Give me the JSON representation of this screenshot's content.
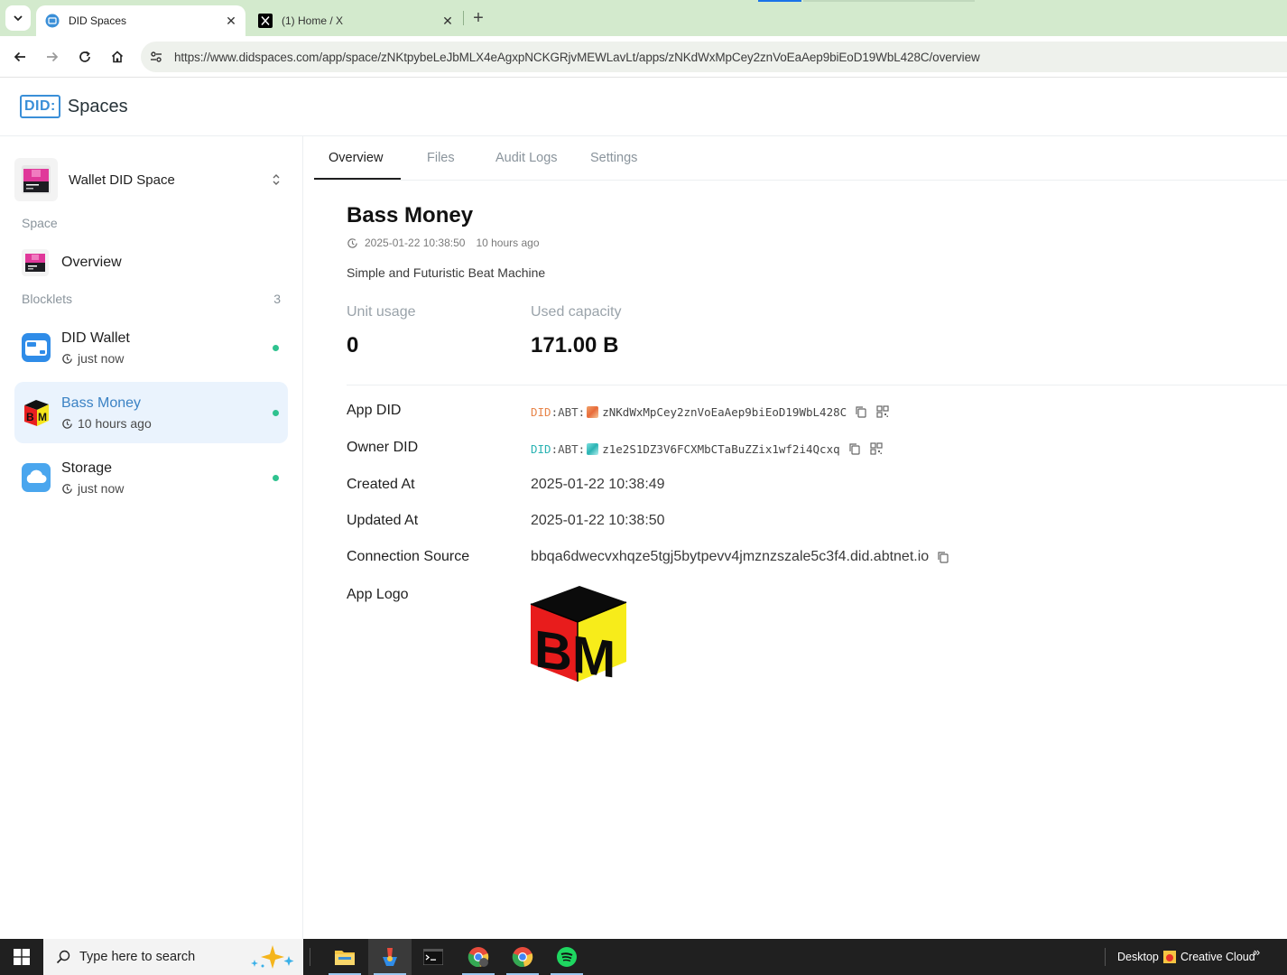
{
  "browser": {
    "tabs": [
      {
        "title": "DID Spaces",
        "icon": "did-spaces-favicon",
        "active": true
      },
      {
        "title": "(1) Home / X",
        "icon": "x-favicon",
        "active": false
      }
    ],
    "url": "https://www.didspaces.com/app/space/zNKtpybeLeJbMLX4eAgxpNCKGRjvMEWLavLt/apps/zNKdWxMpCey2znVoEaAep9biEoD19WbL428C/overview"
  },
  "app": {
    "logo_badge": "DID:",
    "logo_text": "Spaces"
  },
  "sidebar": {
    "space_name": "Wallet DID Space",
    "section_space": "Space",
    "overview_label": "Overview",
    "section_blocklets": "Blocklets",
    "blocklet_count": "3",
    "blocklets": [
      {
        "name": "DID Wallet",
        "time": "just now",
        "status": "running"
      },
      {
        "name": "Bass Money",
        "time": "10 hours ago",
        "status": "running"
      },
      {
        "name": "Storage",
        "time": "just now",
        "status": "running"
      }
    ]
  },
  "main": {
    "tabs": [
      "Overview",
      "Files",
      "Audit Logs",
      "Settings"
    ],
    "active_tab": "Overview",
    "title": "Bass Money",
    "timestamp": "2025-01-22 10:38:50",
    "relative_time": "10 hours ago",
    "description": "Simple and Futuristic Beat Machine",
    "stats": {
      "unit_usage_label": "Unit usage",
      "unit_usage_value": "0",
      "used_capacity_label": "Used capacity",
      "used_capacity_value": "171.00 B"
    },
    "details": {
      "app_did_label": "App DID",
      "app_did_prefix": "DID",
      "app_did_abt": ":ABT:",
      "app_did_value": "zNKdWxMpCey2znVoEaAep9biEoD19WbL428C",
      "owner_did_label": "Owner DID",
      "owner_did_prefix": "DID",
      "owner_did_abt": ":ABT:",
      "owner_did_value": "z1e2S1DZ3V6FCXMbCTaBuZZix1wf2i4Qcxq",
      "created_at_label": "Created At",
      "created_at_value": "2025-01-22 10:38:49",
      "updated_at_label": "Updated At",
      "updated_at_value": "2025-01-22 10:38:50",
      "connection_source_label": "Connection Source",
      "connection_source_value": "bbqa6dwecvxhqze5tgj5bytpevv4jmznzszale5c3f4.did.abtnet.io",
      "app_logo_label": "App Logo",
      "app_logo_letters": "BM"
    }
  },
  "taskbar": {
    "search_placeholder": "Type here to search",
    "apps": [
      "file-explorer",
      "app-launcher",
      "terminal",
      "chrome-profile",
      "chrome",
      "spotify"
    ],
    "desktop_label": "Desktop",
    "creative_cloud_label": "Creative Cloud",
    "overflow": "»"
  },
  "colors": {
    "accent": "#3b82c4",
    "active_bg": "#eaf3fd",
    "status_running": "#2fc28f",
    "tabstrip": "#d3eacd"
  }
}
